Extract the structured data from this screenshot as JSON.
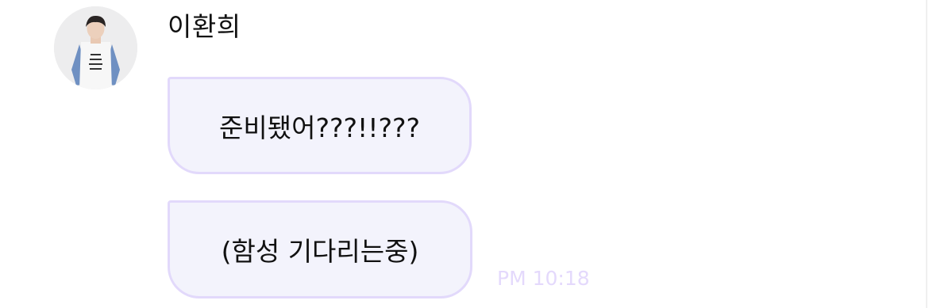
{
  "message_group": {
    "sender": {
      "name": "이환희",
      "avatar_alt": "profile photo"
    },
    "messages": [
      {
        "text": "준비됐어???!!???"
      },
      {
        "text": "(함성 기다리는중)"
      }
    ],
    "timestamp": "PM 10:18"
  },
  "colors": {
    "bubble_background": "#f3f3fc",
    "bubble_border": "#e2d9fb",
    "timestamp": "#e4d9fc",
    "text": "#111111"
  }
}
